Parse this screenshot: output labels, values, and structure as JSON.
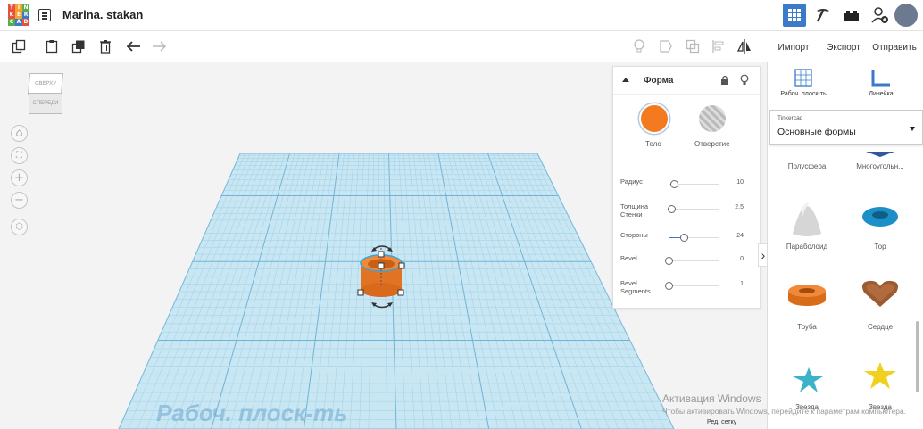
{
  "app": {
    "logo_letters": [
      "T",
      "I",
      "N",
      "K",
      "E",
      "R",
      "C",
      "A",
      "D"
    ],
    "logo_colors": [
      "#e8513b",
      "#f3a32f",
      "#56ad4a",
      "#e8513b",
      "#f3a32f",
      "#3b7ac9",
      "#56ad4a",
      "#3b7ac9",
      "#e8513b"
    ],
    "document_title": "Marina. stakan"
  },
  "toolbar": {
    "import_label": "Импорт",
    "export_label": "Экспорт",
    "send_label": "Отправить"
  },
  "view_cube": {
    "top_label": "СВЕРХУ",
    "front_label": "СПЕРЕДИ"
  },
  "workplane": {
    "label": "Рабоч. плоск-ть"
  },
  "shape_panel": {
    "title": "Форма",
    "solid_label": "Тело",
    "hole_label": "Отверстие",
    "solid_color": "#f47a20",
    "params": [
      {
        "label": "Радиус",
        "value": "10",
        "knob": 0.1
      },
      {
        "label": "Толщина Стенки",
        "value": "2.5",
        "knob": 0.05
      },
      {
        "label": "Стороны",
        "value": "24",
        "knob": 0.3
      },
      {
        "label": "Bevel",
        "value": "0",
        "knob": 0.0
      },
      {
        "label": "Bevel Segments",
        "value": "1",
        "knob": 0.0
      }
    ]
  },
  "right_panel": {
    "workplane_tool": "Рабоч. плоск-ть",
    "ruler_tool": "Линейка",
    "library_source": "Tinkercad",
    "library_name": "Основные формы",
    "shapes": [
      "Полусфера",
      "Многоугольн...",
      "Параболоид",
      "Тор",
      "Труба",
      "Сердце",
      "Звезда",
      "Звезда"
    ]
  },
  "windows_overlay": {
    "title": "Активация Windows",
    "subtitle": "Чтобы активировать Windows, перейдите к параметрам компьютера.",
    "grid_link": "Ред. сетку"
  }
}
